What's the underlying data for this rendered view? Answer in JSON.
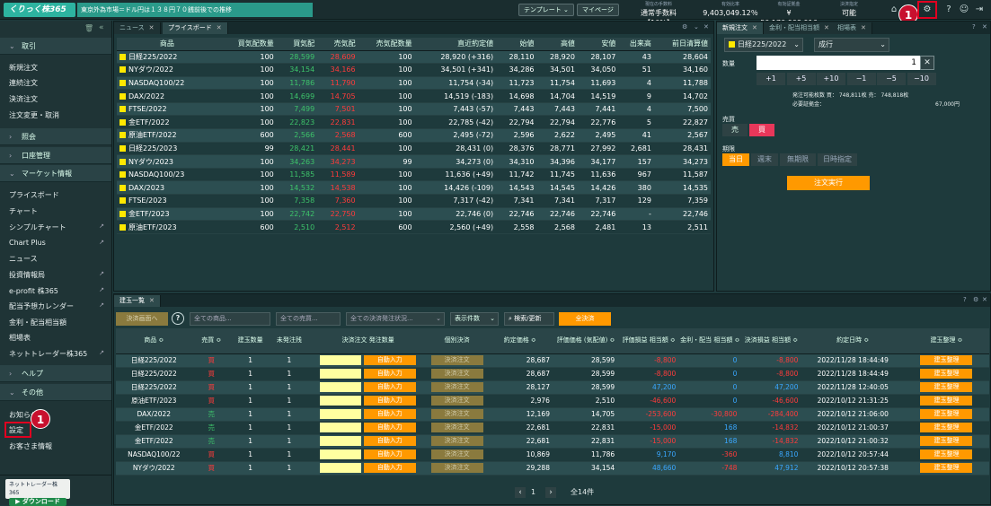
{
  "topbar": {
    "logo": "くりっく株365",
    "ticker": "東京外為市場＝ドル円は１３８円７０銭前後での推移",
    "template": "テンプレート ⌄",
    "mypage": "マイページ",
    "stats": [
      {
        "label": "現在の手数料",
        "value": "通常手数料【10%】"
      },
      {
        "label": "有効比率",
        "value": "9,403,049.12％"
      },
      {
        "label": "有効証拠金",
        "value": "¥ 50,170,908,916"
      },
      {
        "label": "決済指定",
        "value": "可能"
      }
    ],
    "badge": "1"
  },
  "sidebar": {
    "sections": [
      {
        "label": "取引",
        "items": [
          "新規注文",
          "連続注文",
          "決済注文",
          "注文変更・取消"
        ]
      },
      {
        "label": "照会"
      },
      {
        "label": "口座管理"
      },
      {
        "label": "マーケット情報",
        "items": [
          "プライスボード",
          "チャート",
          "シンプルチャート",
          "Chart Plus",
          "ニュース",
          "投資情報局",
          "e-profit 株365",
          "配当予想カレンダー",
          "金利・配当相当額",
          "相場表",
          "ネットトレーダー株365"
        ]
      },
      {
        "label": "ヘルプ"
      },
      {
        "label": "その他",
        "items": [
          "お知らせ",
          "設定",
          "お客さま情報"
        ]
      }
    ],
    "download": {
      "title": "ネットトレーダー株365",
      "button": "ダウンロード"
    }
  },
  "priceboard": {
    "tabs": [
      "ニュース",
      "プライスボード"
    ],
    "headers": [
      "商品",
      "買気配数量",
      "買気配",
      "売気配",
      "売気配数量",
      "直近約定値",
      "始値",
      "高値",
      "安値",
      "出来高",
      "前日清算値"
    ],
    "rows": [
      [
        "日経225/2022",
        "100",
        "28,599",
        "28,609",
        "100",
        "28,920 (+316)",
        "28,110",
        "28,920",
        "28,107",
        "43",
        "28,604"
      ],
      [
        "NYダウ/2022",
        "100",
        "34,154",
        "34,166",
        "100",
        "34,501 (+341)",
        "34,286",
        "34,501",
        "34,050",
        "51",
        "34,160"
      ],
      [
        "NASDAQ100/22",
        "100",
        "11,786",
        "11,790",
        "100",
        "11,754 (-34)",
        "11,723",
        "11,754",
        "11,693",
        "4",
        "11,788"
      ],
      [
        "DAX/2022",
        "100",
        "14,699",
        "14,705",
        "100",
        "14,519 (-183)",
        "14,698",
        "14,704",
        "14,519",
        "9",
        "14,702"
      ],
      [
        "FTSE/2022",
        "100",
        "7,499",
        "7,501",
        "100",
        "7,443 (-57)",
        "7,443",
        "7,443",
        "7,441",
        "4",
        "7,500"
      ],
      [
        "金ETF/2022",
        "100",
        "22,823",
        "22,831",
        "100",
        "22,785 (-42)",
        "22,794",
        "22,794",
        "22,776",
        "5",
        "22,827"
      ],
      [
        "原油ETF/2022",
        "600",
        "2,566",
        "2,568",
        "600",
        "2,495 (-72)",
        "2,596",
        "2,622",
        "2,495",
        "41",
        "2,567"
      ],
      [
        "日経225/2023",
        "99",
        "28,421",
        "28,441",
        "100",
        "28,431 (0)",
        "28,376",
        "28,771",
        "27,992",
        "2,681",
        "28,431"
      ],
      [
        "NYダウ/2023",
        "100",
        "34,263",
        "34,273",
        "99",
        "34,273 (0)",
        "34,310",
        "34,396",
        "34,177",
        "157",
        "34,273"
      ],
      [
        "NASDAQ100/23",
        "100",
        "11,585",
        "11,589",
        "100",
        "11,636 (+49)",
        "11,742",
        "11,745",
        "11,636",
        "967",
        "11,587"
      ],
      [
        "DAX/2023",
        "100",
        "14,532",
        "14,538",
        "100",
        "14,426 (-109)",
        "14,543",
        "14,545",
        "14,426",
        "380",
        "14,535"
      ],
      [
        "FTSE/2023",
        "100",
        "7,358",
        "7,360",
        "100",
        "7,317 (-42)",
        "7,341",
        "7,341",
        "7,317",
        "129",
        "7,359"
      ],
      [
        "金ETF/2023",
        "100",
        "22,742",
        "22,750",
        "100",
        "22,746 (0)",
        "22,746",
        "22,746",
        "22,746",
        "-",
        "22,746"
      ],
      [
        "原油ETF/2023",
        "600",
        "2,510",
        "2,512",
        "600",
        "2,560 (+49)",
        "2,558",
        "2,568",
        "2,481",
        "13",
        "2,511"
      ]
    ]
  },
  "order": {
    "tabs": [
      "新規注文",
      "金利・配当相当額",
      "相場表"
    ],
    "product": "日経225/2022",
    "type": "成行",
    "qty_label": "数量",
    "qty": "1",
    "steps": [
      "+1",
      "+5",
      "+10",
      "−1",
      "−5",
      "−10"
    ],
    "avail": "発注可能枚数 買： 748,811枚 売： 748,818枚",
    "margin_label": "必要証拠金：",
    "margin": "67,000円",
    "side_label": "売買",
    "sell": "売",
    "buy": "買",
    "period_label": "期限",
    "periods": [
      "当日",
      "週末",
      "無期限",
      "日時指定"
    ],
    "submit": "注文実行"
  },
  "positions": {
    "tab": "建玉一覧",
    "toolbar": {
      "settle_screen": "決済画面へ",
      "product_ph": "全ての商品...",
      "side_ph": "全ての売買...",
      "status_ph": "全ての決済発注状況...",
      "count": "表示件数",
      "search": "検索/更新",
      "all_settle": "全決済"
    },
    "headers": [
      "商品 ≎",
      "売買 ≎",
      "建玉数量",
      "未発注残",
      "決済注文 発注数量",
      "個別決済",
      "約定価格 ≎",
      "評価価格 (気配値) ≎",
      "評価損益 相当額 ≎",
      "金利・配当 相当額 ≎",
      "決済損益 相当額 ≎",
      "約定日時 ≎",
      "建玉整理 ≎"
    ],
    "auto": "自動入力",
    "settle": "決済注文",
    "organize": "建玉整理",
    "rows": [
      [
        "日経225/2022",
        "買",
        "1",
        "1",
        "28,687",
        "28,599",
        "-8,800",
        "0",
        "-8,800",
        "2022/11/28 18:44:49"
      ],
      [
        "日経225/2022",
        "買",
        "1",
        "1",
        "28,687",
        "28,599",
        "-8,800",
        "0",
        "-8,800",
        "2022/11/28 18:44:49"
      ],
      [
        "日経225/2022",
        "買",
        "1",
        "1",
        "28,127",
        "28,599",
        "47,200",
        "0",
        "47,200",
        "2022/11/28 12:40:05"
      ],
      [
        "原油ETF/2023",
        "買",
        "1",
        "1",
        "2,976",
        "2,510",
        "-46,600",
        "0",
        "-46,600",
        "2022/10/12 21:31:25"
      ],
      [
        "DAX/2022",
        "売",
        "1",
        "1",
        "12,169",
        "14,705",
        "-253,600",
        "-30,800",
        "-284,400",
        "2022/10/12 21:06:00"
      ],
      [
        "金ETF/2022",
        "売",
        "1",
        "1",
        "22,681",
        "22,831",
        "-15,000",
        "168",
        "-14,832",
        "2022/10/12 21:00:37"
      ],
      [
        "金ETF/2022",
        "売",
        "1",
        "1",
        "22,681",
        "22,831",
        "-15,000",
        "168",
        "-14,832",
        "2022/10/12 21:00:32"
      ],
      [
        "NASDAQ100/22",
        "買",
        "1",
        "1",
        "10,869",
        "11,786",
        "9,170",
        "-360",
        "8,810",
        "2022/10/12 20:57:44"
      ],
      [
        "NYダウ/2022",
        "買",
        "1",
        "1",
        "29,288",
        "34,154",
        "48,660",
        "-748",
        "47,912",
        "2022/10/12 20:57:38"
      ]
    ],
    "page": "1",
    "total": "全14件"
  },
  "colors": {
    "buy": "#ff3b3b",
    "sell": "#3dc36a",
    "accent": "#ff9900",
    "highlight": "#e00020"
  }
}
